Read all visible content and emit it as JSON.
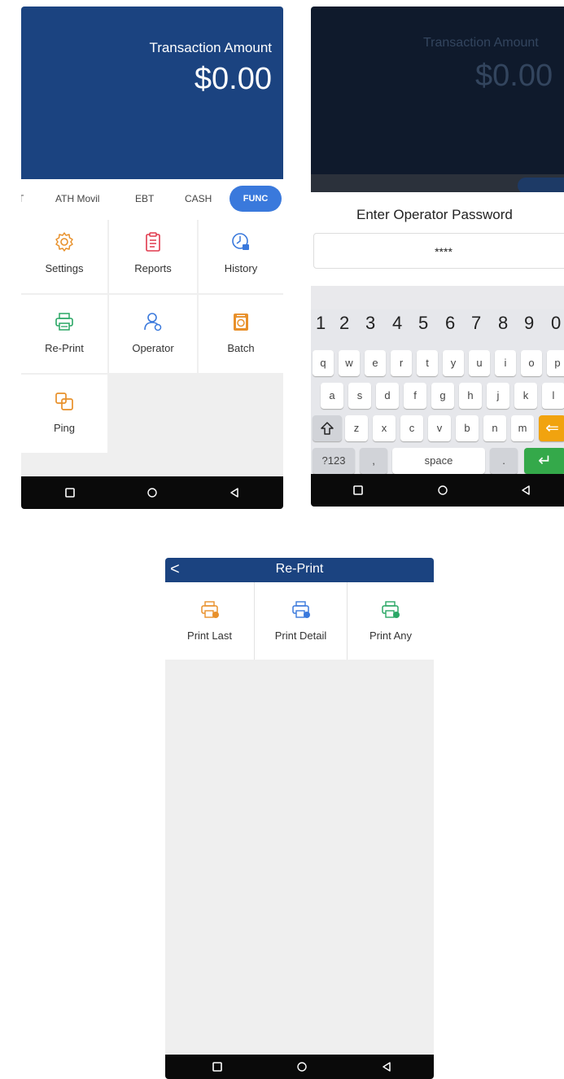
{
  "screen1": {
    "header": {
      "label": "Transaction Amount",
      "amount": "$0.00"
    },
    "tabs": [
      {
        "label": "T"
      },
      {
        "label": "ATH Movil"
      },
      {
        "label": "EBT"
      },
      {
        "label": "CASH"
      },
      {
        "label": "FUNC",
        "active": true
      }
    ],
    "functions": [
      {
        "label": "Settings",
        "icon": "gear-icon",
        "color": "#e8902a"
      },
      {
        "label": "Reports",
        "icon": "clipboard-icon",
        "color": "#e0394c"
      },
      {
        "label": "History",
        "icon": "clock-icon",
        "color": "#3a79dc"
      },
      {
        "label": "Re-Print",
        "icon": "printer-icon",
        "color": "#2aa765"
      },
      {
        "label": "Operator",
        "icon": "user-icon",
        "color": "#3a79dc"
      },
      {
        "label": "Batch",
        "icon": "batch-icon",
        "color": "#e8902a"
      },
      {
        "label": "Ping",
        "icon": "ping-icon",
        "color": "#e8902a"
      }
    ]
  },
  "screen2": {
    "header": {
      "label": "Transaction Amount",
      "amount": "$0.00"
    },
    "dialog": {
      "title": "Enter Operator Password",
      "value": "****"
    },
    "keyboard": {
      "numbers": [
        "1",
        "2",
        "3",
        "4",
        "5",
        "6",
        "7",
        "8",
        "9",
        "0"
      ],
      "row1": [
        "q",
        "w",
        "e",
        "r",
        "t",
        "y",
        "u",
        "i",
        "o",
        "p"
      ],
      "row2": [
        "a",
        "s",
        "d",
        "f",
        "g",
        "h",
        "j",
        "k",
        "l"
      ],
      "row3": [
        "z",
        "x",
        "c",
        "v",
        "b",
        "n",
        "m"
      ],
      "symbols": "?123",
      "comma": ",",
      "space": "space",
      "period": ".",
      "backspace": "⇐",
      "enter": "↵"
    }
  },
  "screen3": {
    "title": "Re-Print",
    "back": "<",
    "options": [
      {
        "label": "Print Last",
        "icon": "print-last-icon",
        "color": "#e8902a"
      },
      {
        "label": "Print Detail",
        "icon": "print-detail-icon",
        "color": "#3a79dc"
      },
      {
        "label": "Print Any",
        "icon": "print-any-icon",
        "color": "#2aa765"
      }
    ]
  },
  "colors": {
    "primary": "#1b4380",
    "accent": "#3a79dc",
    "dark_header": "#0f1a2c"
  }
}
